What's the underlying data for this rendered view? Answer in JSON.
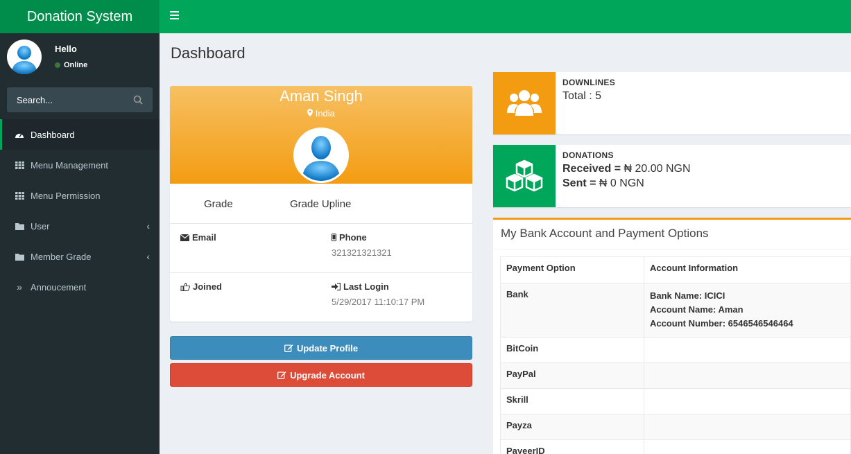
{
  "brand": "Donation System",
  "user": {
    "greeting": "Hello",
    "status": "Online"
  },
  "search": {
    "placeholder": "Search..."
  },
  "menu": [
    {
      "label": "Dashboard",
      "icon": "dashboard-icon"
    },
    {
      "label": "Menu Management",
      "icon": "grid-icon"
    },
    {
      "label": "Menu Permission",
      "icon": "grid-icon"
    },
    {
      "label": "User",
      "icon": "folder-icon"
    },
    {
      "label": "Member Grade",
      "icon": "folder-icon"
    },
    {
      "label": "Annoucement",
      "icon": "double-chevron-icon"
    }
  ],
  "page_title": "Dashboard",
  "profile": {
    "name": "Aman Singh",
    "location": "India",
    "grade_label": "Grade",
    "grade_upline_label": "Grade Upline",
    "email_label": "Email",
    "email_value": "",
    "phone_label": "Phone",
    "phone_value": "321321321321",
    "joined_label": "Joined",
    "joined_value": "",
    "last_login_label": "Last Login",
    "last_login_value": "5/29/2017 11:10:17 PM"
  },
  "buttons": {
    "update": "Update Profile",
    "upgrade": "Upgrade Account"
  },
  "downlines": {
    "title": "DOWNLINES",
    "total": "Total : 5"
  },
  "donations": {
    "title": "DONATIONS",
    "received_label": "Received =",
    "received_value": "₦ 20.00 NGN",
    "sent_label": "Sent =",
    "sent_value": "₦ 0 NGN"
  },
  "bank": {
    "title": "My Bank Account and Payment Options",
    "headers": [
      "Payment Option",
      "Account Information"
    ],
    "rows": [
      {
        "option": "Bank",
        "info": [
          "Bank Name: ICICI",
          "Account Name: Aman",
          "Account Number: 6546546546464"
        ]
      },
      {
        "option": "BitCoin",
        "info": []
      },
      {
        "option": "PayPal",
        "info": []
      },
      {
        "option": "Skrill",
        "info": []
      },
      {
        "option": "Payza",
        "info": []
      },
      {
        "option": "PayeerID",
        "info": []
      }
    ]
  },
  "colors": {
    "green": "#00a65a",
    "dark_green": "#008d4c",
    "orange": "#f39c12",
    "blue": "#3c8dbc",
    "red": "#dd4b39",
    "sidebar": "#222d32"
  }
}
